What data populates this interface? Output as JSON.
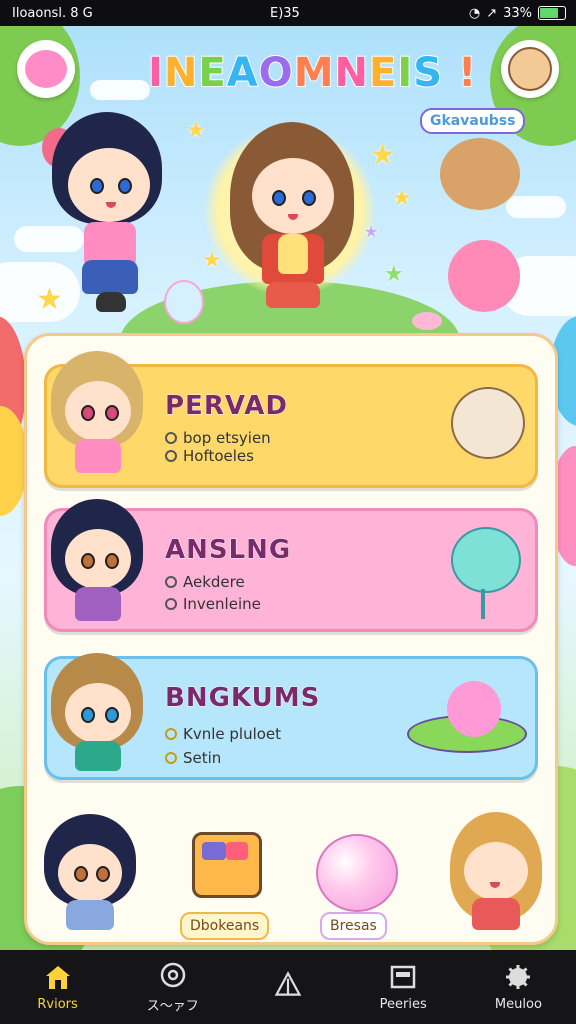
{
  "status_bar": {
    "left": "Iloaonsl. 8 G",
    "time": "E)35",
    "battery": "33%"
  },
  "header": {
    "title": "INEAOMNEIS !",
    "subtitle_badge": "Gkavaubss"
  },
  "cards": [
    {
      "title": "PERVAD",
      "items": [
        "bop etsyien",
        "Hoftoeles"
      ],
      "color": "#ffd86a"
    },
    {
      "title": "ANSLNG",
      "items": [
        "Aekdere",
        "Invenleine"
      ],
      "color": "#ffb3d6"
    },
    {
      "title": "BNGKUMS",
      "items": [
        "Kvnle pluloet",
        "Setin"
      ],
      "color": "#b5e6fb"
    }
  ],
  "bottom_items": [
    {
      "label": "Dbokeans"
    },
    {
      "label": "Bresas"
    }
  ],
  "nav": [
    {
      "label": "Rviors",
      "icon": "home-icon",
      "active": true
    },
    {
      "label": "ス〜ァフ",
      "icon": "compass-icon",
      "active": false
    },
    {
      "label": "",
      "icon": "tent-icon",
      "active": false
    },
    {
      "label": "Peeries",
      "icon": "calendar-icon",
      "active": false
    },
    {
      "label": "Meuloo",
      "icon": "gear-icon",
      "active": false
    }
  ],
  "colors": {
    "accent": "#ffd23a",
    "nav_bg": "#151518",
    "panel_border": "#f6c98a"
  }
}
